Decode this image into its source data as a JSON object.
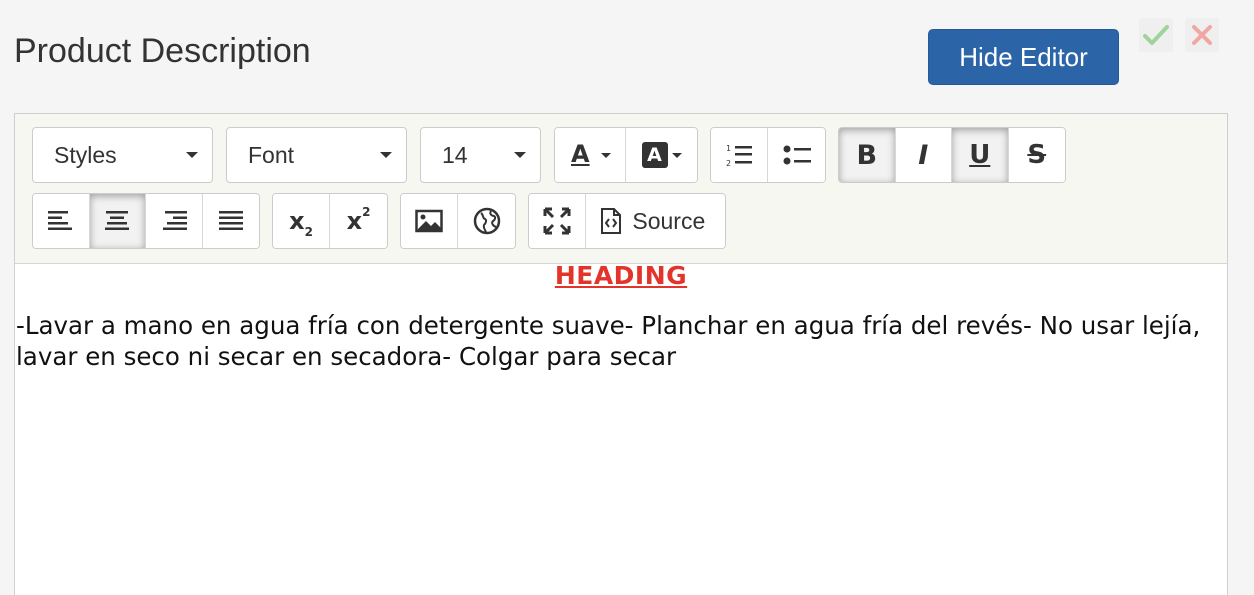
{
  "page": {
    "title": "Product Description"
  },
  "header": {
    "hide_editor_label": "Hide Editor",
    "confirm_icon": "check-icon",
    "cancel_icon": "close-icon",
    "confirm_color": "#9ed39a",
    "cancel_color": "#f0a7a3"
  },
  "toolbar": {
    "styles_value": "Styles",
    "font_value": "Font",
    "size_value": "14",
    "text_color_glyph": "A",
    "bg_color_glyph": "A",
    "ordered_list_icon": "ordered-list-icon",
    "unordered_list_icon": "unordered-list-icon",
    "bold_glyph": "B",
    "italic_glyph": "I",
    "underline_glyph": "U",
    "strike_glyph": "S",
    "active_buttons": [
      "bold",
      "underline",
      "align-center"
    ],
    "subscript_glyph": "x",
    "subscript_index": "2",
    "superscript_glyph": "x",
    "superscript_index": "2",
    "source_label": "Source"
  },
  "content": {
    "heading": "HEADING",
    "heading_color": "#e3342b",
    "body": "-Lavar a mano en agua fría con detergente suave- Planchar en agua fría del revés- No usar lejía, lavar en seco ni secar en secadora- Colgar para secar"
  },
  "colors": {
    "primary_button": "#2c64a8"
  }
}
